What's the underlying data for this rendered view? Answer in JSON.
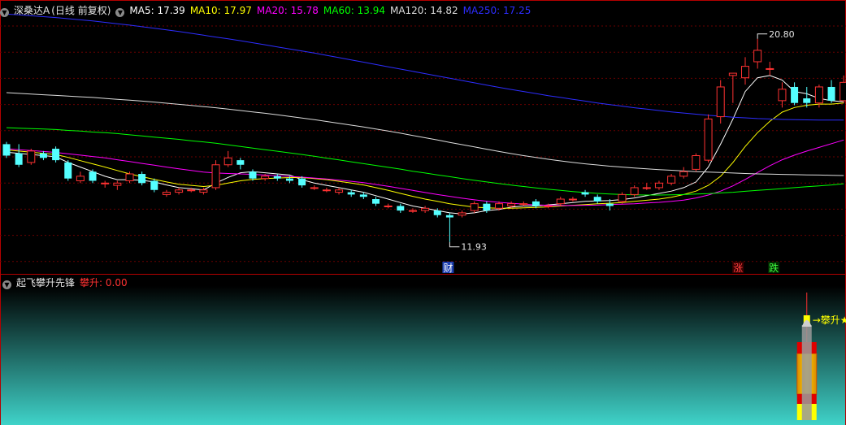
{
  "main_panel": {
    "stock_name": "深桑达A",
    "period": "(日线 前复权)",
    "indicators": [
      {
        "label": "MA5: 17.39",
        "color": "#ffffff"
      },
      {
        "label": "MA10: 17.97",
        "color": "#ffff00"
      },
      {
        "label": "MA20: 15.78",
        "color": "#ff00ff"
      },
      {
        "label": "MA60: 13.94",
        "color": "#00ff00"
      },
      {
        "label": "MA120: 14.82",
        "color": "#dddddd"
      },
      {
        "label": "MA250: 17.25",
        "color": "#2d2dff"
      }
    ],
    "markers": {
      "high": "20.80",
      "low": "11.93",
      "cai": "财",
      "zhang": "涨",
      "die": "跌"
    }
  },
  "sub_panel": {
    "name": "起飞攀升先锋",
    "value_label": "攀升: 0.00",
    "signal_label": "→攀升★"
  },
  "chart_data": [
    {
      "type": "candlestick",
      "price_range": [
        10.5,
        22.0
      ],
      "up_color": "#ff3232",
      "down_color": "#54ffff",
      "candles": [
        [
          16.2,
          15.7,
          16.3,
          15.6
        ],
        [
          15.8,
          15.3,
          16.2,
          15.2
        ],
        [
          15.4,
          15.9,
          16.0,
          15.3
        ],
        [
          15.8,
          15.6,
          15.9,
          15.5
        ],
        [
          16.0,
          15.5,
          16.1,
          15.4
        ],
        [
          15.4,
          14.7,
          15.5,
          14.6
        ],
        [
          14.6,
          14.8,
          15.0,
          14.5
        ],
        [
          15.0,
          14.6,
          15.1,
          14.5
        ],
        [
          14.5,
          14.5,
          14.6,
          14.3
        ],
        [
          14.4,
          14.5,
          14.6,
          14.2
        ],
        [
          14.6,
          14.9,
          15.0,
          14.5
        ],
        [
          14.9,
          14.5,
          15.0,
          14.4
        ],
        [
          14.6,
          14.2,
          14.7,
          14.1
        ],
        [
          14.0,
          14.1,
          14.2,
          13.9
        ],
        [
          14.1,
          14.2,
          14.3,
          14.0
        ],
        [
          14.2,
          14.2,
          14.3,
          14.1
        ],
        [
          14.1,
          14.2,
          14.3,
          14.0
        ],
        [
          14.3,
          15.3,
          15.5,
          14.2
        ],
        [
          15.3,
          15.6,
          15.9,
          15.2
        ],
        [
          15.5,
          15.3,
          15.6,
          15.1
        ],
        [
          15.0,
          14.7,
          15.1,
          14.6
        ],
        [
          14.7,
          14.8,
          14.9,
          14.6
        ],
        [
          14.8,
          14.7,
          14.9,
          14.6
        ],
        [
          14.7,
          14.6,
          14.8,
          14.5
        ],
        [
          14.7,
          14.4,
          14.8,
          14.3
        ],
        [
          14.3,
          14.3,
          14.4,
          14.2
        ],
        [
          14.2,
          14.2,
          14.3,
          14.1
        ],
        [
          14.1,
          14.2,
          14.3,
          14.0
        ],
        [
          14.1,
          14.0,
          14.2,
          13.9
        ],
        [
          14.0,
          13.9,
          14.1,
          13.8
        ],
        [
          13.8,
          13.6,
          13.9,
          13.5
        ],
        [
          13.5,
          13.5,
          13.6,
          13.4
        ],
        [
          13.5,
          13.3,
          13.6,
          13.2
        ],
        [
          13.3,
          13.3,
          13.4,
          13.2
        ],
        [
          13.3,
          13.4,
          13.5,
          13.2
        ],
        [
          13.3,
          13.1,
          13.4,
          13.0
        ],
        [
          13.1,
          13.0,
          13.2,
          11.93
        ],
        [
          13.1,
          13.2,
          13.3,
          13.0
        ],
        [
          13.3,
          13.6,
          13.7,
          13.2
        ],
        [
          13.6,
          13.3,
          13.7,
          13.2
        ],
        [
          13.4,
          13.6,
          13.7,
          13.3
        ],
        [
          13.5,
          13.6,
          13.7,
          13.4
        ],
        [
          13.6,
          13.6,
          13.7,
          13.5
        ],
        [
          13.7,
          13.5,
          13.8,
          13.4
        ],
        [
          13.5,
          13.5,
          13.6,
          13.4
        ],
        [
          13.6,
          13.8,
          13.9,
          13.5
        ],
        [
          13.8,
          13.8,
          13.9,
          13.7
        ],
        [
          14.1,
          14.0,
          14.2,
          13.9
        ],
        [
          13.9,
          13.7,
          14.0,
          13.6
        ],
        [
          13.6,
          13.5,
          13.8,
          13.3
        ],
        [
          13.7,
          14.0,
          14.1,
          13.6
        ],
        [
          14.0,
          14.3,
          14.4,
          13.9
        ],
        [
          14.3,
          14.3,
          14.5,
          14.2
        ],
        [
          14.3,
          14.5,
          14.6,
          14.2
        ],
        [
          14.5,
          14.8,
          14.9,
          14.4
        ],
        [
          14.8,
          15.0,
          15.2,
          14.7
        ],
        [
          15.1,
          15.7,
          15.8,
          15.0
        ],
        [
          15.5,
          17.3,
          17.5,
          15.4
        ],
        [
          17.4,
          18.7,
          19.0,
          17.1
        ],
        [
          19.2,
          19.3,
          19.3,
          18.0
        ],
        [
          19.1,
          19.6,
          20.0,
          18.8
        ],
        [
          19.8,
          20.3,
          20.8,
          19.5
        ],
        [
          19.5,
          19.5,
          19.8,
          19.2
        ],
        [
          18.1,
          18.6,
          18.9,
          17.8
        ],
        [
          18.7,
          18.0,
          18.9,
          17.9
        ],
        [
          18.2,
          18.0,
          18.7,
          17.8
        ],
        [
          18.0,
          18.7,
          18.8,
          17.8
        ],
        [
          18.7,
          18.1,
          19.0,
          18.0
        ],
        [
          18.1,
          18.9,
          19.2,
          18.0
        ]
      ],
      "ma_series": [
        {
          "name": "MA5",
          "color": "#ffffff",
          "values": [
            15.85,
            15.8,
            15.75,
            15.7,
            15.65,
            15.4,
            15.2,
            15.0,
            14.8,
            14.65,
            14.65,
            14.62,
            14.55,
            14.42,
            14.3,
            14.25,
            14.2,
            14.5,
            14.75,
            14.95,
            15.0,
            14.95,
            14.9,
            14.85,
            14.65,
            14.5,
            14.4,
            14.3,
            14.2,
            14.1,
            13.95,
            13.8,
            13.65,
            13.5,
            13.4,
            13.3,
            13.2,
            13.15,
            13.2,
            13.3,
            13.35,
            13.45,
            13.5,
            13.5,
            13.55,
            13.6,
            13.65,
            13.7,
            13.72,
            13.74,
            13.78,
            13.85,
            13.95,
            14.05,
            14.15,
            14.3,
            14.55,
            15.2,
            16.2,
            17.3,
            18.5,
            19.1,
            19.2,
            19.0,
            18.5,
            18.4,
            18.2,
            18.1,
            18.05
          ]
        },
        {
          "name": "MA10",
          "color": "#ffff00",
          "values": [
            15.95,
            15.9,
            15.85,
            15.8,
            15.75,
            15.62,
            15.48,
            15.34,
            15.2,
            15.05,
            14.9,
            14.78,
            14.66,
            14.55,
            14.45,
            14.4,
            14.35,
            14.4,
            14.5,
            14.6,
            14.66,
            14.7,
            14.72,
            14.74,
            14.74,
            14.7,
            14.65,
            14.58,
            14.5,
            14.42,
            14.3,
            14.18,
            14.05,
            13.92,
            13.8,
            13.7,
            13.6,
            13.52,
            13.45,
            13.42,
            13.4,
            13.4,
            13.42,
            13.44,
            13.46,
            13.5,
            13.53,
            13.56,
            13.6,
            13.62,
            13.65,
            13.7,
            13.75,
            13.8,
            13.88,
            14.0,
            14.15,
            14.4,
            14.8,
            15.4,
            16.1,
            16.7,
            17.2,
            17.6,
            17.8,
            17.9,
            17.95,
            17.95,
            18.0
          ]
        },
        {
          "name": "MA20",
          "color": "#ff00ff",
          "values": [
            16.0,
            15.96,
            15.92,
            15.88,
            15.84,
            15.78,
            15.72,
            15.66,
            15.6,
            15.52,
            15.44,
            15.36,
            15.28,
            15.2,
            15.12,
            15.05,
            14.98,
            14.94,
            14.92,
            14.9,
            14.88,
            14.85,
            14.82,
            14.79,
            14.76,
            14.72,
            14.68,
            14.63,
            14.58,
            14.52,
            14.44,
            14.36,
            14.27,
            14.18,
            14.09,
            14.0,
            13.92,
            13.84,
            13.77,
            13.71,
            13.66,
            13.62,
            13.58,
            13.55,
            13.53,
            13.52,
            13.52,
            13.53,
            13.54,
            13.56,
            13.58,
            13.6,
            13.63,
            13.66,
            13.7,
            13.76,
            13.85,
            13.98,
            14.15,
            14.38,
            14.66,
            14.96,
            15.26,
            15.52,
            15.72,
            15.9,
            16.06,
            16.22,
            16.38
          ]
        },
        {
          "name": "MA60",
          "color": "#00ff00",
          "values": [
            16.92,
            16.9,
            16.88,
            16.86,
            16.84,
            16.8,
            16.77,
            16.73,
            16.7,
            16.66,
            16.61,
            16.56,
            16.51,
            16.46,
            16.41,
            16.35,
            16.3,
            16.24,
            16.17,
            16.1,
            16.03,
            15.96,
            15.89,
            15.82,
            15.75,
            15.67,
            15.59,
            15.51,
            15.43,
            15.35,
            15.27,
            15.19,
            15.11,
            15.02,
            14.94,
            14.86,
            14.78,
            14.7,
            14.62,
            14.55,
            14.48,
            14.41,
            14.35,
            14.29,
            14.23,
            14.18,
            14.13,
            14.09,
            14.05,
            14.02,
            14.0,
            13.99,
            13.98,
            13.98,
            13.99,
            14.0,
            14.02,
            14.04,
            14.07,
            14.1,
            14.14,
            14.18,
            14.22,
            14.26,
            14.3,
            14.34,
            14.38,
            14.42,
            14.47
          ]
        },
        {
          "name": "MA120",
          "color": "#dddddd",
          "values": [
            18.45,
            18.42,
            18.39,
            18.36,
            18.33,
            18.3,
            18.27,
            18.24,
            18.2,
            18.16,
            18.12,
            18.08,
            18.04,
            17.99,
            17.94,
            17.89,
            17.84,
            17.79,
            17.73,
            17.67,
            17.61,
            17.55,
            17.48,
            17.41,
            17.34,
            17.27,
            17.19,
            17.11,
            17.03,
            16.95,
            16.86,
            16.77,
            16.68,
            16.58,
            16.48,
            16.38,
            16.28,
            16.18,
            16.08,
            15.98,
            15.88,
            15.79,
            15.7,
            15.62,
            15.54,
            15.47,
            15.4,
            15.34,
            15.29,
            15.24,
            15.2,
            15.16,
            15.12,
            15.09,
            15.06,
            15.03,
            15.0,
            14.98,
            14.96,
            14.94,
            14.92,
            14.9,
            14.89,
            14.88,
            14.87,
            14.86,
            14.85,
            14.84,
            14.83
          ]
        },
        {
          "name": "MA250",
          "color": "#2d2dff",
          "values": [
            21.88,
            21.85,
            21.81,
            21.77,
            21.73,
            21.68,
            21.63,
            21.58,
            21.52,
            21.46,
            21.4,
            21.33,
            21.26,
            21.19,
            21.12,
            21.04,
            20.96,
            20.88,
            20.8,
            20.72,
            20.63,
            20.54,
            20.45,
            20.36,
            20.27,
            20.18,
            20.08,
            19.98,
            19.88,
            19.78,
            19.68,
            19.58,
            19.48,
            19.38,
            19.28,
            19.18,
            19.08,
            18.98,
            18.88,
            18.78,
            18.68,
            18.59,
            18.5,
            18.41,
            18.32,
            18.24,
            18.16,
            18.08,
            18.0,
            17.93,
            17.86,
            17.79,
            17.73,
            17.67,
            17.61,
            17.56,
            17.51,
            17.46,
            17.42,
            17.38,
            17.35,
            17.32,
            17.3,
            17.28,
            17.27,
            17.26,
            17.25,
            17.25,
            17.25
          ]
        }
      ]
    },
    {
      "type": "bar",
      "series_name": "攀升",
      "signal_index": 65,
      "value": 0.0
    }
  ]
}
